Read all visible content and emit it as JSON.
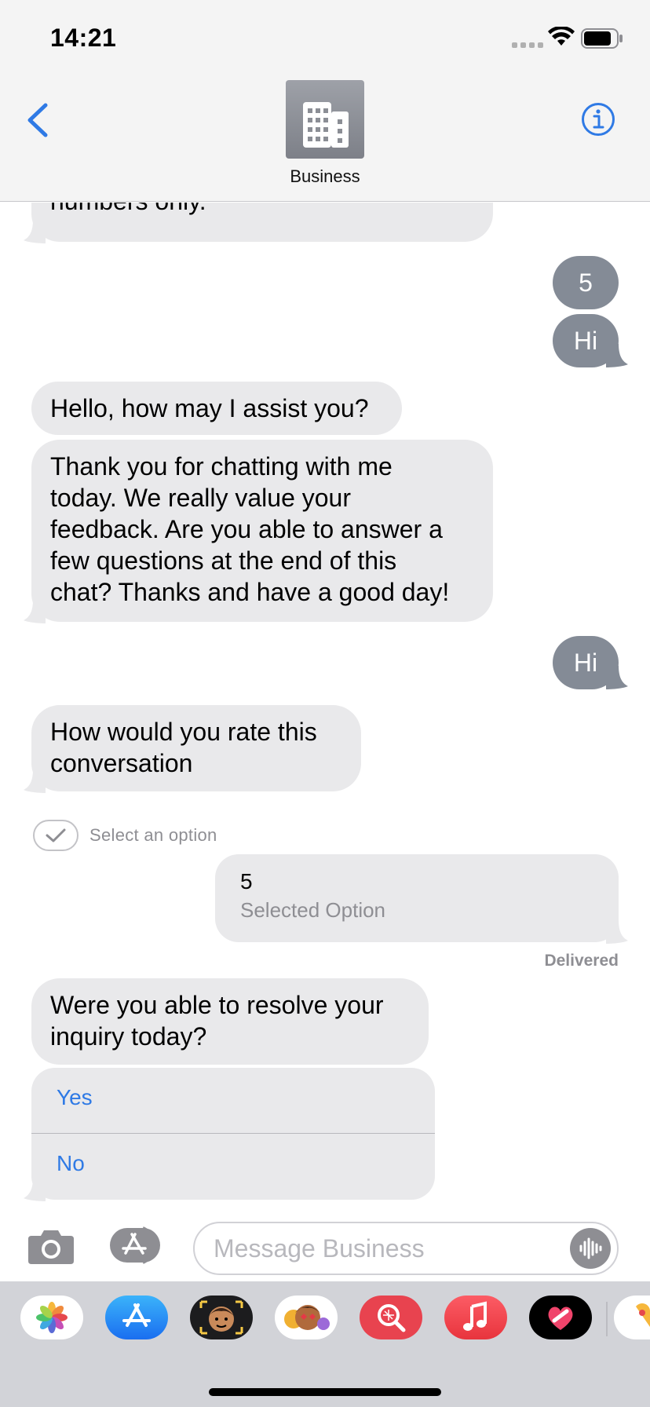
{
  "status_bar": {
    "time": "14:21"
  },
  "header": {
    "contact_name": "Business"
  },
  "messages": {
    "partial_incoming": "numbers only.",
    "out_5": "5",
    "out_hi_1": "Hi",
    "in_hello": "Hello, how may I assist you?",
    "in_thanks_lines": [
      "Thank you for chatting with me",
      "today. We really value your",
      "feedback. Are you able to answer a",
      "few questions at the end of this",
      "chat? Thanks and have a good day!"
    ],
    "out_hi_2": "Hi",
    "in_rate_lines": [
      "How would you rate this",
      "conversation"
    ],
    "select_option_label": "Select an option",
    "selected_value": "5",
    "selected_caption": "Selected Option",
    "delivered": "Delivered",
    "in_resolve_lines": [
      "Were you able to resolve your",
      "inquiry today?"
    ],
    "options": [
      "Yes",
      "No"
    ]
  },
  "input_bar": {
    "placeholder": "Message Business"
  },
  "app_drawer": {
    "apps": [
      "photos-icon",
      "app-store-icon",
      "memoji-icon",
      "animoji-icon",
      "image-search-icon",
      "music-icon",
      "digital-touch-icon",
      "maps-icon"
    ]
  },
  "colors": {
    "accent": "#2f7ae5",
    "incoming_bubble": "#e9e9eb",
    "outgoing_bubble": "#848b96",
    "header_bg": "#f4f4f4",
    "drawer_bg": "#d2d3d8"
  }
}
